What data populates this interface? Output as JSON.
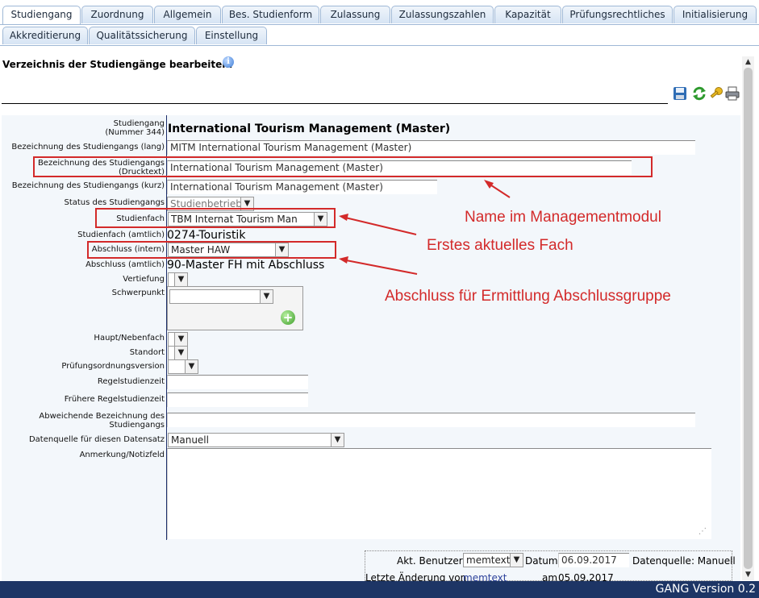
{
  "tabs_row1": [
    {
      "label": "Studiengang",
      "active": true
    },
    {
      "label": "Zuordnung"
    },
    {
      "label": "Allgemein"
    },
    {
      "label": "Bes. Studienform"
    },
    {
      "label": "Zulassung"
    },
    {
      "label": "Zulassungszahlen"
    },
    {
      "label": "Kapazität"
    },
    {
      "label": "Prüfungsrechtliches"
    },
    {
      "label": "Initialisierung"
    }
  ],
  "tabs_row2": [
    {
      "label": "Akkreditierung"
    },
    {
      "label": "Qualitätssicherung"
    },
    {
      "label": "Einstellung"
    }
  ],
  "heading": "Verzeichnis der Studiengänge bearbeiten.",
  "info_icon": "i",
  "toolbar": {
    "icons": [
      "save-icon",
      "refresh-icon",
      "key-icon",
      "print-icon"
    ]
  },
  "form": {
    "studiengang_label": "Studiengang",
    "studiengang_number": "(Nummer 344)",
    "studiengang_value": "International Tourism Management (Master)",
    "bez_lang_label": "Bezeichnung des Studiengangs (lang)",
    "bez_lang_value": "MITM International Tourism Management (Master)",
    "bez_druck_label": "Bezeichnung des Studiengangs (Drucktext)",
    "bez_druck_value": "International Tourism Management (Master)",
    "bez_kurz_label": "Bezeichnung des Studiengangs (kurz)",
    "bez_kurz_value": "International Tourism Management (Master)",
    "status_label": "Status des Studiengangs",
    "status_value": "Studienbetrieb",
    "studienfach_label": "Studienfach",
    "studienfach_value": "TBM Internat Tourism Man",
    "studienfach_amtlich_label": "Studienfach (amtlich)",
    "studienfach_amtlich_value": "0274-Touristik",
    "abschluss_intern_label": "Abschluss (intern)",
    "abschluss_intern_value": "Master HAW",
    "abschluss_amtlich_label": "Abschluss (amtlich)",
    "abschluss_amtlich_value": "90-Master FH mit Abschluss",
    "vertiefung_label": "Vertiefung",
    "schwerpunkt_label": "Schwerpunkt",
    "add_symbol": "+",
    "haupt_neben_label": "Haupt/Nebenfach",
    "standort_label": "Standort",
    "pruefungsordnung_label": "Prüfungsordnungsversion",
    "regelstudienzeit_label": "Regelstudienzeit",
    "fruehere_regel_label": "Frühere Regelstudienzeit",
    "abweichende_label": "Abweichende Bezeichnung des Studiengangs",
    "datenquelle_label": "Datenquelle für diesen Datensatz",
    "datenquelle_value": "Manuell",
    "anmerkung_label": "Anmerkung/Notizfeld"
  },
  "annotations": {
    "name_mgmt": "Name im Managementmodul",
    "erstes_fach": "Erstes aktuelles Fach",
    "abschluss_gruppe": "Abschluss für Ermittlung Abschlussgruppe"
  },
  "footer": {
    "akt_benutzer_label": "Akt. Benutzer",
    "akt_benutzer_value": "memtext",
    "datum_label": "Datum",
    "datum_value": "06.09.2017",
    "datenquelle": "Datenquelle: Manuell",
    "letzte_aenderung_label": "Letzte Änderung von",
    "letzte_aenderung_user": "memtext",
    "am_label": "am",
    "am_value": "05.09.2017"
  },
  "version": "GANG Version 0.2",
  "colors": {
    "accent_red": "#d32a2a",
    "bottom_bar": "#1d3565",
    "tab_border": "#9fb8d6"
  }
}
